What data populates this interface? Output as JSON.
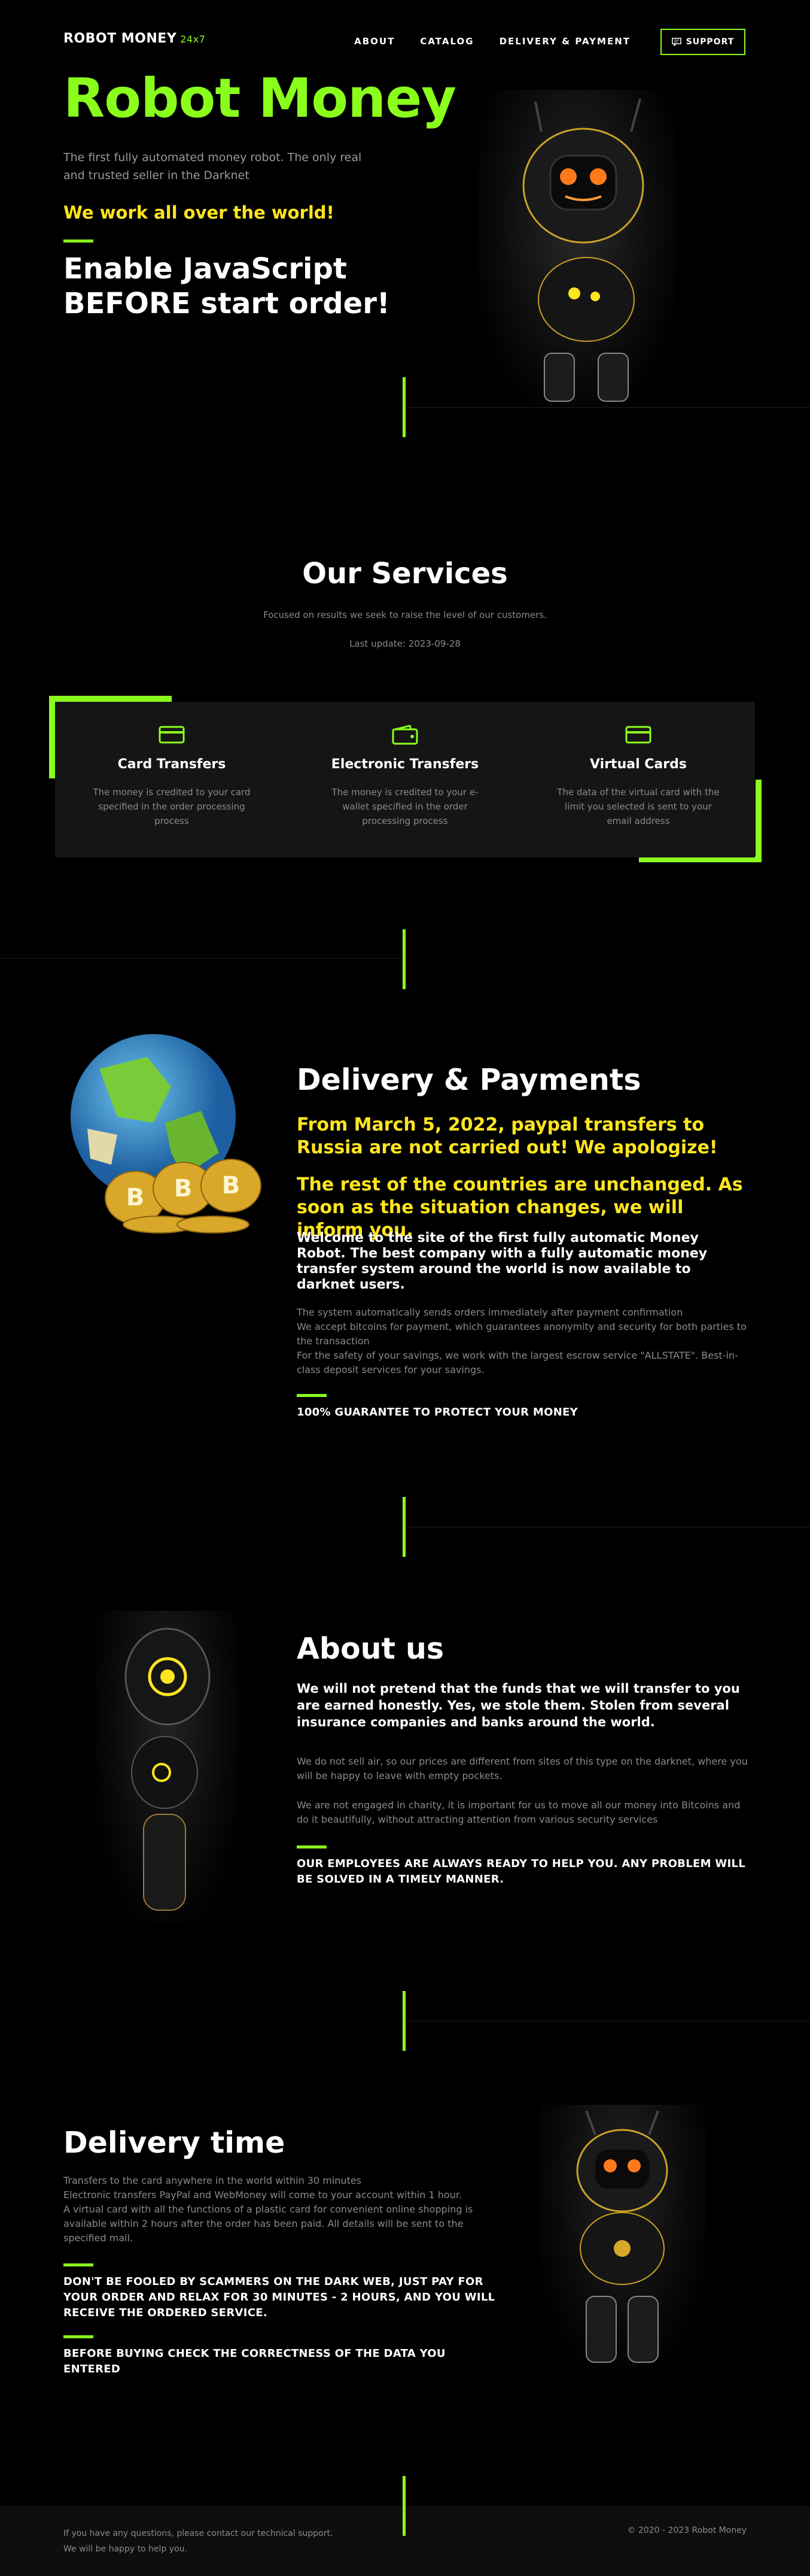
{
  "header": {
    "logo": "ROBOT MONEY",
    "logo_sub": "24x7",
    "nav": [
      "ABOUT",
      "CATALOG",
      "DELIVERY & PAYMENT"
    ],
    "support_label": "SUPPORT"
  },
  "hero": {
    "title": "Robot Money",
    "description": "The first fully automated money robot. The only real and trusted seller in the Darknet",
    "world": "We work all over the world!",
    "js_notice": "Enable JavaScript BEFORE start order!"
  },
  "services": {
    "title": "Our Services",
    "subtitle": "Focused on results we seek to raise the level of our customers.",
    "last_update": "Last update: 2023-09-28",
    "items": [
      {
        "icon": "credit-card-icon",
        "title": "Card Transfers",
        "desc": "The money is credited to your card specified in the order processing process"
      },
      {
        "icon": "wallet-icon",
        "title": "Electronic Transfers",
        "desc": "The money is credited to your e-wallet specified in the order processing process"
      },
      {
        "icon": "virtual-card-icon",
        "title": "Virtual Cards",
        "desc": "The data of the virtual card with the limit you selected is sent to your email address"
      }
    ]
  },
  "delivery": {
    "title": "Delivery & Payments",
    "notice1": "From March 5, 2022, paypal transfers to Russia are not carried out! We apologize!",
    "notice2": "The rest of the countries are unchanged. As soon as the situation changes, we will inform you.",
    "welcome": "Welcome to the site of the first fully automatic Money Robot. The best company with a fully automatic money transfer system around the world is now available to darknet users.",
    "p1": "The system automatically sends orders immediately after payment confirmation",
    "p2": "We accept bitcoins for payment, which guarantees anonymity and security for both parties to the transaction",
    "p3": "For the safety of your savings, we work with the largest escrow service \"ALLSTATE\". Best-in-class deposit services for your savings.",
    "guarantee": "100% GUARANTEE TO PROTECT YOUR MONEY"
  },
  "about": {
    "title": "About us",
    "lead": "We will not pretend that the funds that we will transfer to you are earned honestly. Yes, we stole them. Stolen from several insurance companies and banks around the world.",
    "p1": "We do not sell air, so our prices are different from sites of this type on the darknet, where you will be happy to leave with empty pockets.",
    "p2": "We are not engaged in charity, it is important for us to move all our money into Bitcoins and do it beautifully, without attracting attention from various security services",
    "caps": "OUR EMPLOYEES ARE ALWAYS READY TO HELP YOU. ANY PROBLEM WILL BE SOLVED IN A TIMELY MANNER."
  },
  "delivery_time": {
    "title": "Delivery time",
    "p1": "Transfers to the card anywhere in the world within 30 minutes",
    "p2": "Electronic transfers PayPal and WebMoney will come to your account within 1 hour.",
    "p3": "A virtual card with all the functions of a plastic card for convenient online shopping is available within 2 hours after the order has been paid. All details will be sent to the specified mail.",
    "caps1": "DON'T BE FOOLED BY SCAMMERS ON THE DARK WEB, JUST PAY FOR YOUR ORDER AND RELAX FOR 30 MINUTES - 2 HOURS, AND YOU WILL RECEIVE THE ORDERED SERVICE.",
    "caps2": "BEFORE BUYING CHECK THE CORRECTNESS OF THE DATA YOU ENTERED"
  },
  "footer": {
    "line1": "If you have any questions, please contact our technical support.",
    "line2": "We will be happy to help you.",
    "copyright": "© 2020 - 2023 Robot Money"
  },
  "colors": {
    "accent": "#8bff1c",
    "warning": "#ffe51f",
    "background": "#000000"
  }
}
